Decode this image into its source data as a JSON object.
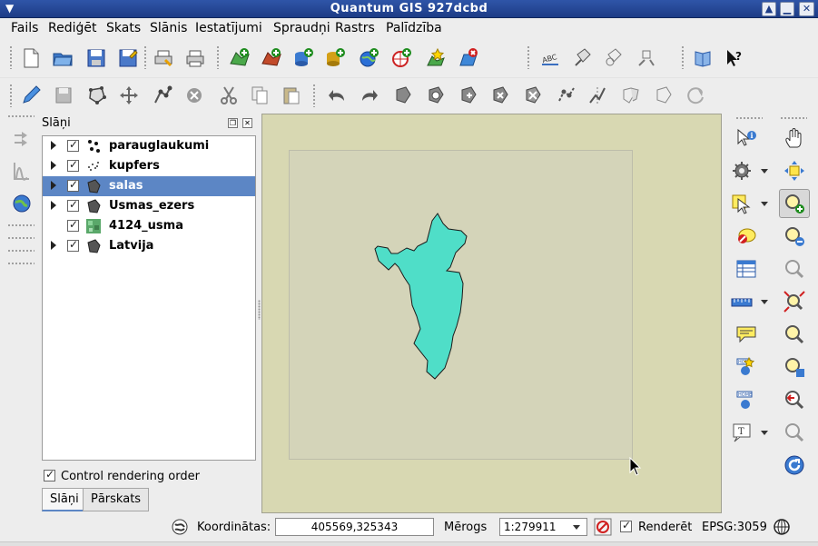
{
  "window": {
    "title": "Quantum GIS 927dcbd"
  },
  "menu": {
    "items": [
      "Fails",
      "Rediģēt",
      "Skats",
      "Slānis",
      "Iestatījumi",
      "Spraudņi",
      "Rastrs",
      "Palīdzība"
    ]
  },
  "layers_panel": {
    "title": "Slāņi",
    "layers": [
      {
        "name": "parauglaukumi",
        "checked": true,
        "expandable": true,
        "selected": false,
        "icon": "point-layer-icon"
      },
      {
        "name": "kupfers",
        "checked": true,
        "expandable": true,
        "selected": false,
        "icon": "point-cloud-layer-icon"
      },
      {
        "name": "salas",
        "checked": true,
        "expandable": true,
        "selected": true,
        "icon": "polygon-layer-icon"
      },
      {
        "name": "Usmas_ezers",
        "checked": true,
        "expandable": true,
        "selected": false,
        "icon": "polygon-layer-icon"
      },
      {
        "name": "4124_usma",
        "checked": true,
        "expandable": false,
        "selected": false,
        "icon": "raster-layer-icon"
      },
      {
        "name": "Latvija",
        "checked": true,
        "expandable": true,
        "selected": false,
        "icon": "polygon-layer-icon"
      }
    ],
    "control_rendering_order": {
      "label": "Control rendering order",
      "checked": true
    },
    "tabs": [
      "Slāņi",
      "Pārskats"
    ],
    "active_tab": "Slāņi"
  },
  "map": {
    "background_color": "#d8d8b2",
    "feature_fill": "#4fdec8"
  },
  "statusbar": {
    "coordinates_label": "Koordinātas:",
    "coordinates_value": "405569,325343",
    "scale_label": "Mērogs",
    "scale_value": "1:279911",
    "render_label": "Renderēt",
    "render_checked": true,
    "crs": "EPSG:3059"
  }
}
